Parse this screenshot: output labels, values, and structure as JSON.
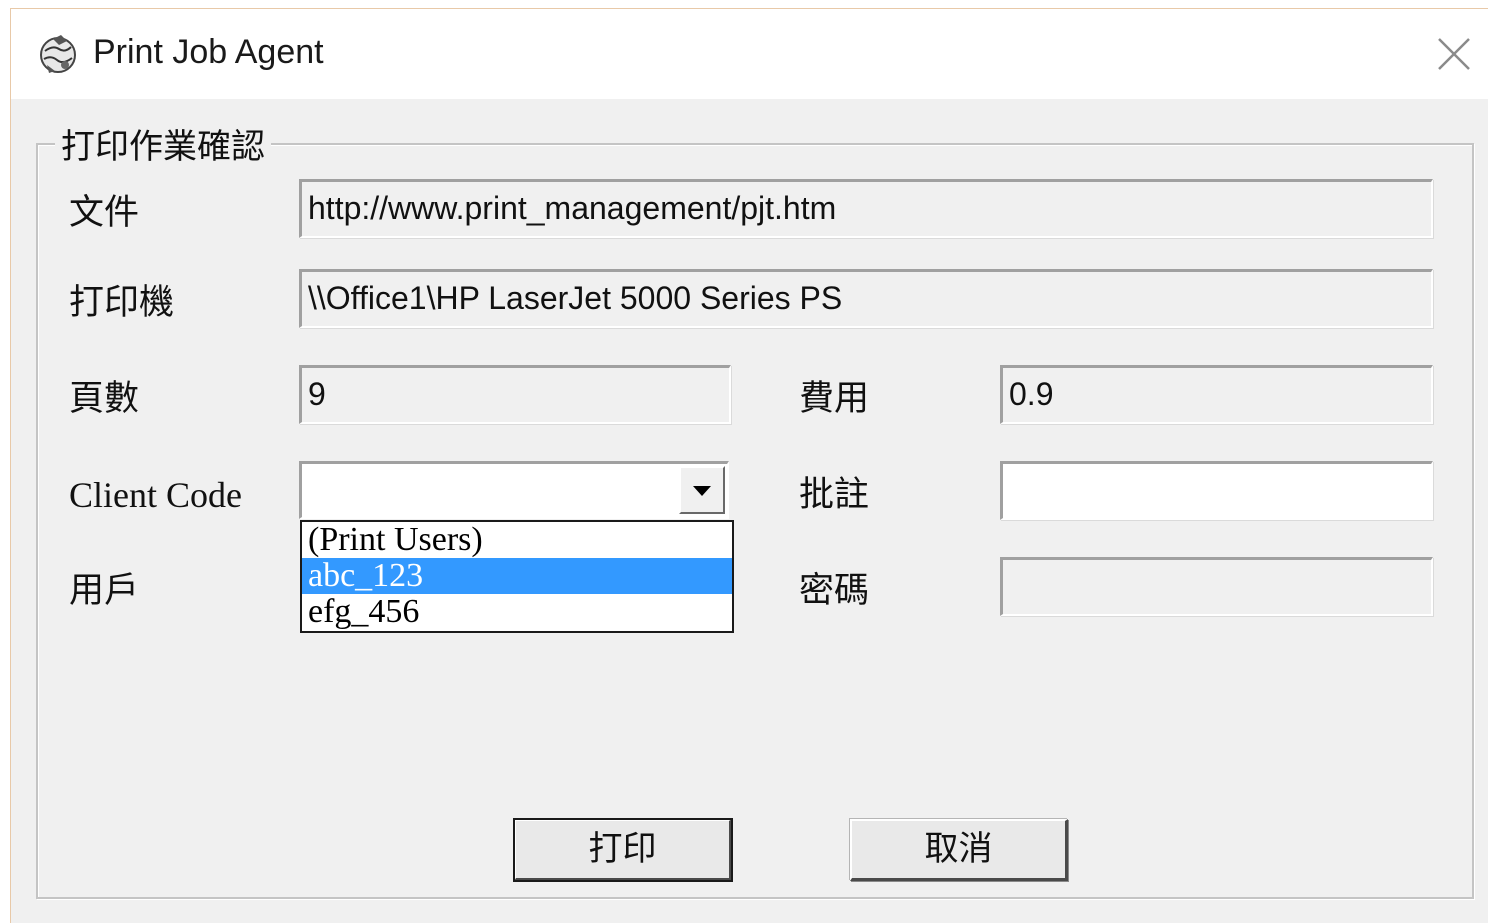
{
  "window": {
    "title": "Print Job Agent",
    "app_icon": "print-agent-globe-icon",
    "close_icon": "close-icon"
  },
  "group": {
    "title": "打印作業確認"
  },
  "fields": {
    "document_label": "文件",
    "document_value": "http://www.print_management/pjt.htm",
    "printer_label": "打印機",
    "printer_value": "\\\\Office1\\HP LaserJet 5000 Series PS",
    "pages_label": "頁數",
    "pages_value": "9",
    "cost_label": "費用",
    "cost_value": "0.9",
    "client_code_label": "Client Code",
    "client_code_value": "",
    "comment_label": "批註",
    "comment_value": "",
    "user_label": "用戶",
    "password_label": "密碼",
    "password_value": ""
  },
  "client_code_dropdown": {
    "items": [
      "(Print Users)",
      "abc_123",
      "efg_456"
    ],
    "highlighted": "abc_123"
  },
  "buttons": {
    "print_label": "打印",
    "cancel_label": "取消"
  },
  "colors": {
    "dialog_bg": "#f0f0f0",
    "highlight": "#3399ff"
  }
}
